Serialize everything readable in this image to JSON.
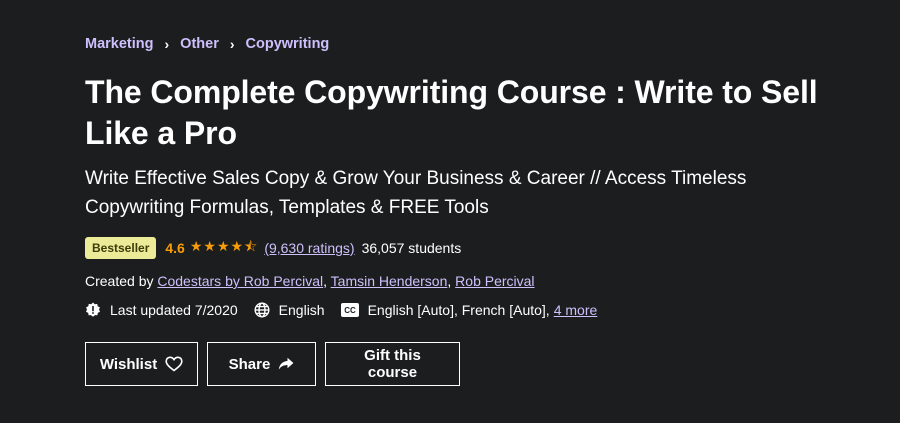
{
  "breadcrumb": {
    "items": [
      "Marketing",
      "Other",
      "Copywriting"
    ],
    "separator": "›"
  },
  "course": {
    "title": "The Complete Copywriting Course : Write to Sell Like a Pro",
    "subtitle": "Write Effective Sales Copy & Grow Your Business & Career // Access Timeless Copywriting Formulas, Templates & FREE Tools",
    "badge": "Bestseller",
    "rating": "4.6",
    "stars": "★★★★⯪",
    "ratings_count": "(9,630 ratings)",
    "students": "36,057 students",
    "created_by_label": "Created by",
    "instructors": [
      "Codestars by Rob Percival",
      "Tamsin Henderson",
      "Rob Percival"
    ],
    "instructor_sep": ", ",
    "last_updated": "Last updated 7/2020",
    "language": "English",
    "captions": "English [Auto], French [Auto],",
    "more_captions": "4 more"
  },
  "actions": {
    "wishlist": "Wishlist",
    "share": "Share",
    "gift": "Gift this course"
  },
  "colors": {
    "background": "#1c1d1f",
    "link": "#cec0fc",
    "star": "#f69c08",
    "badge_bg": "#eceb98",
    "badge_text": "#3d3c0a"
  },
  "icons": {
    "last_updated": "alert-badge-icon",
    "language": "globe-icon",
    "captions": "closed-captions-icon",
    "wishlist": "heart-icon",
    "share": "share-arrow-icon",
    "breadcrumb": "chevron-right-icon"
  }
}
